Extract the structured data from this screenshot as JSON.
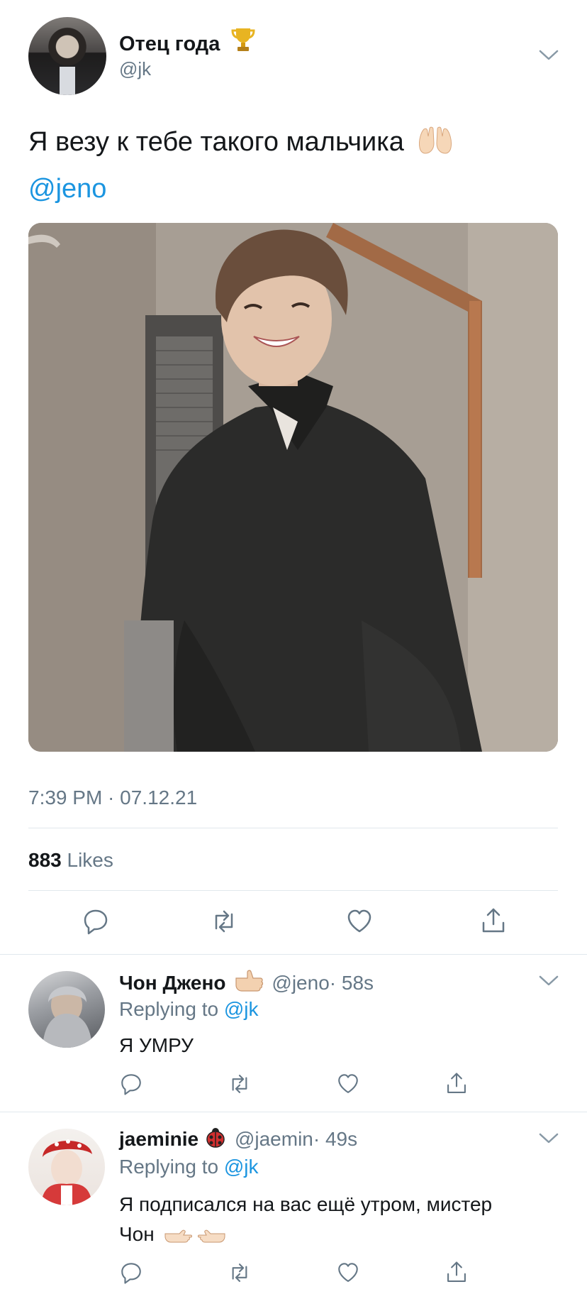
{
  "tweet": {
    "author_name": "Отец года",
    "author_handle": "@jk",
    "text": "Я везу к тебе такого мальчика",
    "mention": "@jeno",
    "timestamp": "7:39 PM · 07.12.21",
    "likes_count": "883",
    "likes_label": "Likes"
  },
  "replies": [
    {
      "name": "Чон Джено",
      "handle": "@jeno",
      "time": "· 58s",
      "replying_prefix": "Replying to",
      "replying_to": "@jk",
      "text": "Я УМРУ"
    },
    {
      "name": "jaeminie",
      "handle": "@jaemin",
      "time": "· 49s",
      "replying_prefix": "Replying to",
      "replying_to": "@jk",
      "text_line1": "Я подписался на вас ещё утром, мистер",
      "text_line2": "Чон"
    }
  ],
  "icons": {
    "trophy": "trophy-icon",
    "hands": "raised-hands-icon",
    "reply": "reply-icon",
    "retweet": "retweet-icon",
    "like": "heart-icon",
    "share": "share-icon",
    "menu": "chevron-down-icon"
  },
  "colors": {
    "link": "#1b95e0",
    "secondary_text": "#657786",
    "divider": "#e1e8ed"
  }
}
